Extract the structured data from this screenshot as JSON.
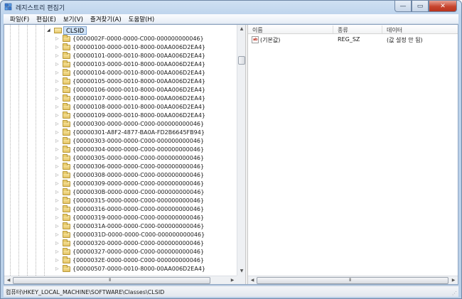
{
  "window": {
    "title": "레지스트리 편집기",
    "minimize_glyph": "—",
    "maximize_glyph": "▭",
    "close_glyph": "✕",
    "app_icon": "registry-editor-icon"
  },
  "menu": [
    "파일(F)",
    "편집(E)",
    "보기(V)",
    "즐겨찾기(A)",
    "도움말(H)"
  ],
  "tree": {
    "selected": "CLSID",
    "collapse_glyph": "◢",
    "expand_glyph": "▷",
    "items": [
      "{0000002F-0000-0000-C000-000000000046}",
      "{00000100-0000-0010-8000-00AA006D2EA4}",
      "{00000101-0000-0010-8000-00AA006D2EA4}",
      "{00000103-0000-0010-8000-00AA006D2EA4}",
      "{00000104-0000-0010-8000-00AA006D2EA4}",
      "{00000105-0000-0010-8000-00AA006D2EA4}",
      "{00000106-0000-0010-8000-00AA006D2EA4}",
      "{00000107-0000-0010-8000-00AA006D2EA4}",
      "{00000108-0000-0010-8000-00AA006D2EA4}",
      "{00000109-0000-0010-8000-00AA006D2EA4}",
      "{00000300-0000-0000-C000-000000000046}",
      "{00000301-A8F2-4877-BA0A-FD2B6645FB94}",
      "{00000303-0000-0000-C000-000000000046}",
      "{00000304-0000-0000-C000-000000000046}",
      "{00000305-0000-0000-C000-000000000046}",
      "{00000306-0000-0000-C000-000000000046}",
      "{00000308-0000-0000-C000-000000000046}",
      "{00000309-0000-0000-C000-000000000046}",
      "{0000030B-0000-0000-C000-000000000046}",
      "{00000315-0000-0000-C000-000000000046}",
      "{00000316-0000-0000-C000-000000000046}",
      "{00000319-0000-0000-C000-000000000046}",
      "{0000031A-0000-0000-C000-000000000046}",
      "{0000031D-0000-0000-C000-000000000046}",
      "{00000320-0000-0000-C000-000000000046}",
      "{00000327-0000-0000-C000-000000000046}",
      "{0000032E-0000-0000-C000-000000000046}",
      "{00000507-0000-0010-8000-00AA006D2EA4}"
    ]
  },
  "scroll": {
    "up": "▲",
    "down": "▼",
    "left": "◀",
    "right": "▶",
    "grip": "III"
  },
  "list": {
    "columns": [
      "이름",
      "종류",
      "데이터"
    ],
    "rows": [
      {
        "icon_text": "ab",
        "name": "(기본값)",
        "type": "REG_SZ",
        "data": "(값 설정 안 됨)"
      }
    ]
  },
  "status": {
    "path": "컴퓨터\\HKEY_LOCAL_MACHINE\\SOFTWARE\\Classes\\CLSID",
    "grip": "⋰"
  }
}
